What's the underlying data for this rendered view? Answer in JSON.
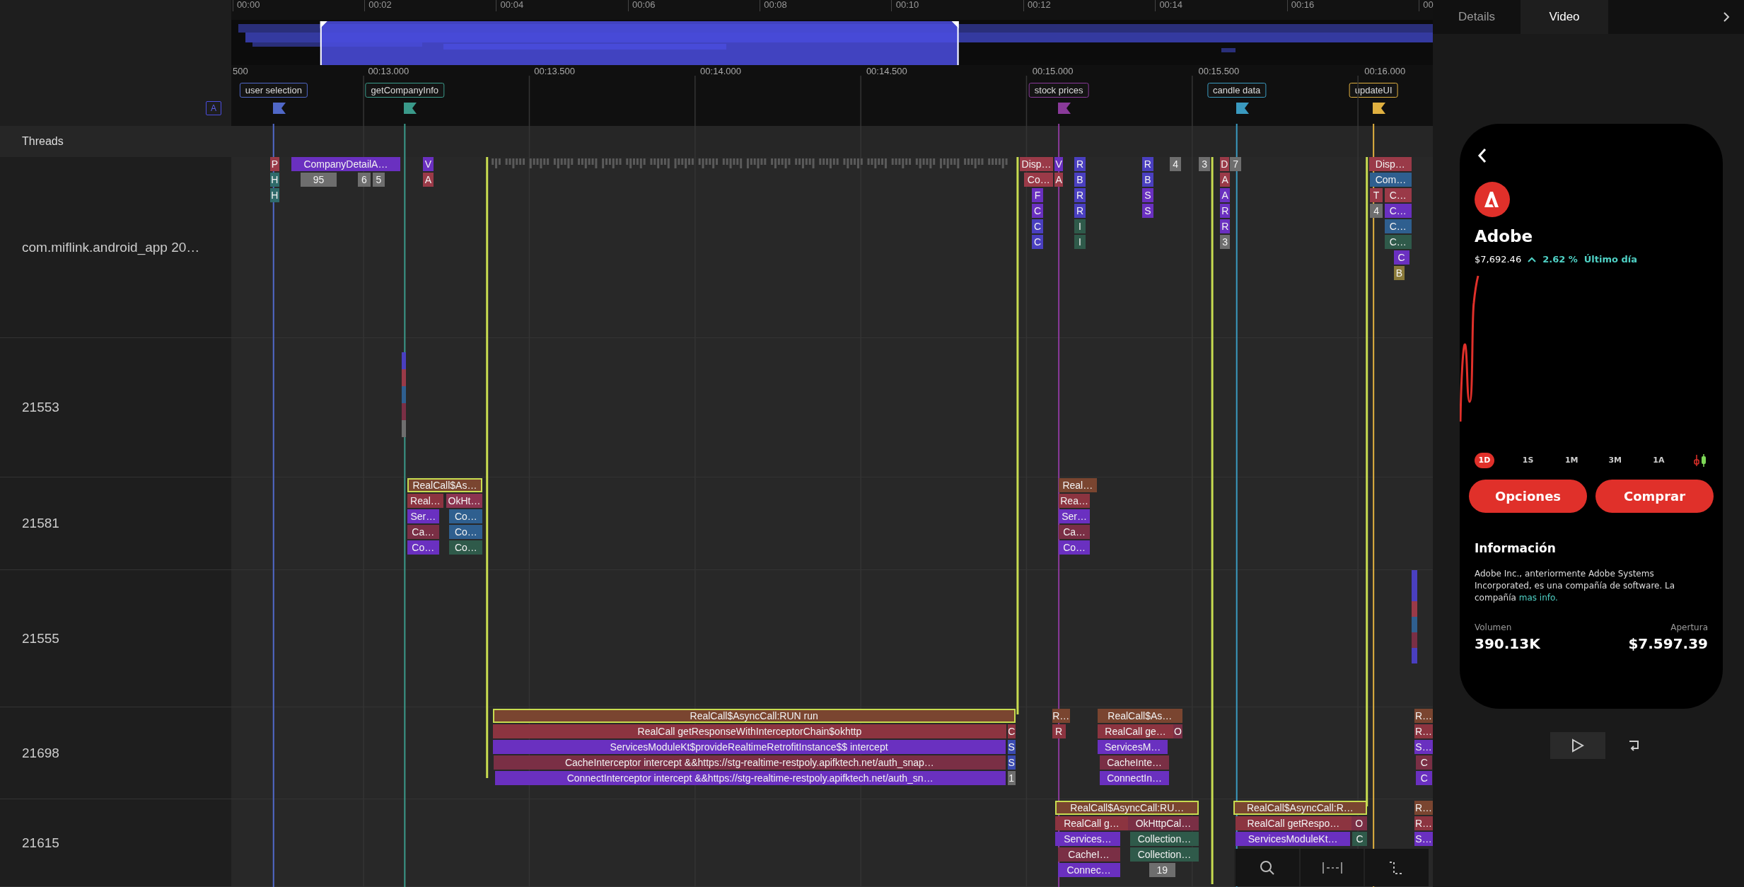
{
  "annotation_toggle": {
    "label": "A"
  },
  "overview": {
    "ticks": [
      "00:00",
      "00:02",
      "00:04",
      "00:06",
      "00:08",
      "00:10",
      "00:12",
      "00:14",
      "00:16",
      "00"
    ]
  },
  "ruler": {
    "ticks": [
      "500",
      "00:13.000",
      "00:13.500",
      "00:14.000",
      "00:14.500",
      "00:15.000",
      "00:15.500",
      "00:16.000"
    ]
  },
  "markers": [
    {
      "label": "user selection",
      "color": "#5068c8"
    },
    {
      "label": "getCompanyInfo",
      "color": "#3a9a8a"
    },
    {
      "label": "stock prices",
      "color": "#8a3a9a"
    },
    {
      "label": "candle data",
      "color": "#3a9ac0"
    },
    {
      "label": "updateUI",
      "color": "#e0b040"
    }
  ],
  "threads_header": "Threads",
  "threads": [
    {
      "label": "com.miflink.android_app 20…",
      "slices": [
        {
          "text": "P",
          "color": "#9a3a48",
          "highlighted": false
        },
        {
          "text": "CompanyDetailA…",
          "color": "#6a30c0",
          "highlighted": false
        },
        {
          "text": "V",
          "color": "#6a30c0",
          "highlighted": false
        },
        {
          "text": "Disp…",
          "color": "#9a3a48",
          "highlighted": false
        },
        {
          "text": "V",
          "color": "#6a30c0",
          "highlighted": false
        },
        {
          "text": "R",
          "color": "#4a3fc0",
          "highlighted": false
        },
        {
          "text": "R",
          "color": "#4a3fc0",
          "highlighted": false
        },
        {
          "text": "4",
          "color": "#6e6e6e",
          "highlighted": false
        },
        {
          "text": "3",
          "color": "#6e6e6e",
          "highlighted": false
        },
        {
          "text": "D",
          "color": "#9a3a48",
          "highlighted": false
        },
        {
          "text": "7",
          "color": "#6e6e6e",
          "highlighted": false
        },
        {
          "text": "Disp…",
          "color": "#9a3a48",
          "highlighted": false
        },
        {
          "text": "H",
          "color": "#2f6a6a",
          "highlighted": false
        },
        {
          "text": "95",
          "color": "#6e6e6e",
          "highlighted": false
        },
        {
          "text": "6",
          "color": "#6e6e6e",
          "highlighted": false
        },
        {
          "text": "5",
          "color": "#6e6e6e",
          "highlighted": false
        },
        {
          "text": "A",
          "color": "#9a3a48",
          "highlighted": false
        },
        {
          "text": "Co…",
          "color": "#9a3a48",
          "highlighted": false
        },
        {
          "text": "A",
          "color": "#9a3a48",
          "highlighted": false
        },
        {
          "text": "B",
          "color": "#4a3fc0",
          "highlighted": false
        },
        {
          "text": "B",
          "color": "#4a3fc0",
          "highlighted": false
        },
        {
          "text": "A",
          "color": "#9a3a48",
          "highlighted": false
        },
        {
          "text": "Com…",
          "color": "#2f5f8f",
          "highlighted": false
        },
        {
          "text": "H",
          "color": "#2f6a6a",
          "highlighted": false
        },
        {
          "text": "F",
          "color": "#6a30c0",
          "highlighted": false
        },
        {
          "text": "R",
          "color": "#4a3fc0",
          "highlighted": false
        },
        {
          "text": "S",
          "color": "#6a30c0",
          "highlighted": false
        },
        {
          "text": "A",
          "color": "#6a30c0",
          "highlighted": false
        },
        {
          "text": "T",
          "color": "#9a3a48",
          "highlighted": false
        },
        {
          "text": "C…",
          "color": "#9a3a48",
          "highlighted": false
        },
        {
          "text": "C",
          "color": "#6a30c0",
          "highlighted": false
        },
        {
          "text": "R",
          "color": "#4a3fc0",
          "highlighted": false
        },
        {
          "text": "S",
          "color": "#6a30c0",
          "highlighted": false
        },
        {
          "text": "R",
          "color": "#6a30c0",
          "highlighted": false
        },
        {
          "text": "4",
          "color": "#6e6e6e",
          "highlighted": false
        },
        {
          "text": "C…",
          "color": "#6a30c0",
          "highlighted": false
        },
        {
          "text": "C",
          "color": "#4a3fc0",
          "highlighted": false
        },
        {
          "text": "I",
          "color": "#2f5a4a",
          "highlighted": false
        },
        {
          "text": "R",
          "color": "#6a30c0",
          "highlighted": false
        },
        {
          "text": "C…",
          "color": "#2f5f8f",
          "highlighted": false
        },
        {
          "text": "C",
          "color": "#4a3fc0",
          "highlighted": false
        },
        {
          "text": "I",
          "color": "#2f5a4a",
          "highlighted": false
        },
        {
          "text": "3",
          "color": "#6e6e6e",
          "highlighted": false
        },
        {
          "text": "C…",
          "color": "#2f5a4a",
          "highlighted": false
        },
        {
          "text": "C",
          "color": "#6a30c0",
          "highlighted": false
        },
        {
          "text": "B",
          "color": "#8a7a3a",
          "highlighted": false
        }
      ]
    },
    {
      "label": "21553"
    },
    {
      "label": "21581",
      "slices": [
        {
          "text": "RealCall$As…",
          "color": "#7a4530",
          "highlighted": true
        },
        {
          "text": "Real…",
          "color": "#7a4530",
          "highlighted": false
        },
        {
          "text": "Real…",
          "color": "#8c3440",
          "highlighted": false
        },
        {
          "text": "OkHt…",
          "color": "#8c3450",
          "highlighted": false
        },
        {
          "text": "Rea…",
          "color": "#8c3440",
          "highlighted": false
        },
        {
          "text": "Ser…",
          "color": "#6a30c0",
          "highlighted": false
        },
        {
          "text": "Co…",
          "color": "#2f5f8f",
          "highlighted": false
        },
        {
          "text": "Ser…",
          "color": "#6a30c0",
          "highlighted": false
        },
        {
          "text": "Ca…",
          "color": "#7a2f45",
          "highlighted": false
        },
        {
          "text": "Co…",
          "color": "#2f5f8f",
          "highlighted": false
        },
        {
          "text": "Ca…",
          "color": "#7a2f45",
          "highlighted": false
        },
        {
          "text": "Co…",
          "color": "#6a30c0",
          "highlighted": false
        },
        {
          "text": "Co…",
          "color": "#2f5a4a",
          "highlighted": false
        },
        {
          "text": "Co…",
          "color": "#6a30c0",
          "highlighted": false
        }
      ]
    },
    {
      "label": "21555"
    },
    {
      "label": "21698",
      "slices": [
        {
          "text": "RealCall$AsyncCall:RUN run",
          "color": "#7a4530",
          "highlighted": true
        },
        {
          "text": "R…",
          "color": "#7a4530",
          "highlighted": false
        },
        {
          "text": "RealCall$As…",
          "color": "#7a4530",
          "highlighted": false
        },
        {
          "text": "R…",
          "color": "#7a4530",
          "highlighted": false
        },
        {
          "text": "RealCall getResponseWithInterceptorChain$okhttp",
          "color": "#8c3440",
          "highlighted": false
        },
        {
          "text": "C",
          "color": "#8c3440",
          "highlighted": false
        },
        {
          "text": "R",
          "color": "#8c3440",
          "highlighted": false
        },
        {
          "text": "RealCall ge…",
          "color": "#8c3440",
          "highlighted": false
        },
        {
          "text": "O",
          "color": "#7a2f45",
          "highlighted": false
        },
        {
          "text": "R…",
          "color": "#8c3440",
          "highlighted": false
        },
        {
          "text": "ServicesModuleKt$provideRealtimeRetrofitInstance$$ intercept",
          "color": "#6a30c0",
          "highlighted": false
        },
        {
          "text": "S",
          "color": "#3a4ab0",
          "highlighted": false
        },
        {
          "text": "ServicesM…",
          "color": "#6a30c0",
          "highlighted": false
        },
        {
          "text": "S…",
          "color": "#6a30c0",
          "highlighted": false
        },
        {
          "text": "CacheInterceptor intercept &&https://stg-realtime-restpoly.apifktech.net/auth_snap…",
          "color": "#7a2f45",
          "highlighted": false
        },
        {
          "text": "S",
          "color": "#3a4ab0",
          "highlighted": false
        },
        {
          "text": "CacheInte…",
          "color": "#7a2f45",
          "highlighted": false
        },
        {
          "text": "C",
          "color": "#7a2f45",
          "highlighted": false
        },
        {
          "text": "ConnectInterceptor intercept &&https://stg-realtime-restpoly.apifktech.net/auth_sn…",
          "color": "#6a30c0",
          "highlighted": false
        },
        {
          "text": "1",
          "color": "#6e6e6e",
          "highlighted": false
        },
        {
          "text": "ConnectIn…",
          "color": "#6a30c0",
          "highlighted": false
        },
        {
          "text": "C",
          "color": "#6a30c0",
          "highlighted": false
        }
      ]
    },
    {
      "label": "21615",
      "slices": [
        {
          "text": "RealCall$AsyncCall:RU…",
          "color": "#7a4530",
          "highlighted": true
        },
        {
          "text": "RealCall$AsyncCall:R…",
          "color": "#7a4530",
          "highlighted": true
        },
        {
          "text": "R…",
          "color": "#7a4530",
          "highlighted": false
        },
        {
          "text": "RealCall g…",
          "color": "#8c3440",
          "highlighted": false
        },
        {
          "text": "OkHttpCal…",
          "color": "#7a2f45",
          "highlighted": false
        },
        {
          "text": "RealCall getRespo…",
          "color": "#8c3440",
          "highlighted": false
        },
        {
          "text": "O",
          "color": "#7a2f45",
          "highlighted": false
        },
        {
          "text": "R…",
          "color": "#8c3440",
          "highlighted": false
        },
        {
          "text": "Services…",
          "color": "#6a30c0",
          "highlighted": false
        },
        {
          "text": "Collection…",
          "color": "#2f5a4a",
          "highlighted": false
        },
        {
          "text": "ServicesModuleKt…",
          "color": "#6a30c0",
          "highlighted": false
        },
        {
          "text": "C",
          "color": "#2f5a4a",
          "highlighted": false
        },
        {
          "text": "S…",
          "color": "#6a30c0",
          "highlighted": false
        },
        {
          "text": "CacheI…",
          "color": "#7a2f45",
          "highlighted": false
        },
        {
          "text": "Collection…",
          "color": "#2f5a4a",
          "highlighted": false
        },
        {
          "text": "Connec…",
          "color": "#6a30c0",
          "highlighted": false
        },
        {
          "text": "19",
          "color": "#6e6e6e",
          "highlighted": false
        }
      ]
    }
  ],
  "side_panel": {
    "tabs": [
      {
        "label": "Details",
        "selected": false
      },
      {
        "label": "Video",
        "selected": true
      }
    ],
    "phone": {
      "company": "Adobe",
      "price": "$7,692.46",
      "change": "2.62 %",
      "change_period": "Último día",
      "periods": [
        {
          "label": "1D",
          "selected": true
        },
        {
          "label": "1S",
          "selected": false
        },
        {
          "label": "1M",
          "selected": false
        },
        {
          "label": "3M",
          "selected": false
        },
        {
          "label": "1A",
          "selected": false
        }
      ],
      "buttons": [
        "Opciones",
        "Comprar"
      ],
      "info_title": "Información",
      "info_text": "Adobe Inc., anteriormente Adobe Systems Incorporated, es una compañía de software. La compañía",
      "info_link": "mas info.",
      "stats": [
        {
          "label": "Volumen",
          "value": "390.13K"
        },
        {
          "label": "Apertura",
          "value": "$7.597.39"
        }
      ]
    }
  }
}
